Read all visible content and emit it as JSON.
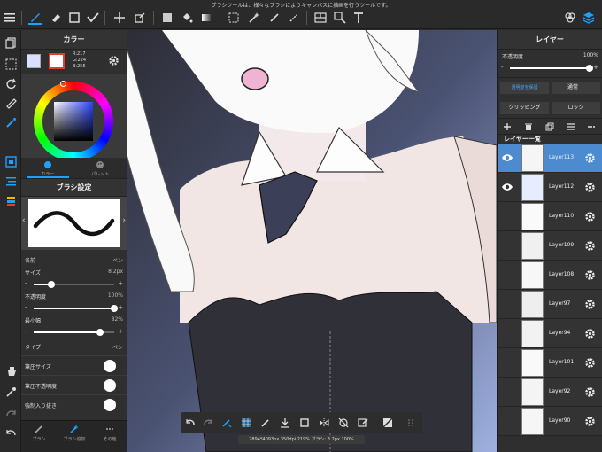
{
  "status_message": "ブラシツールは、様々なブラシによりキャンバスに描画を行うツールです。",
  "toolbar": {
    "icons": [
      "menu-icon",
      "brush-icon",
      "eraser-icon",
      "square-icon",
      "pen-icon",
      "move-icon",
      "transform-icon",
      "fill-color-icon",
      "bucket-icon",
      "gradient-icon",
      "select-rect-icon",
      "magic-wand-icon",
      "pen-select-icon",
      "select-pen-icon",
      "frame-icon",
      "filter-icon",
      "text-icon",
      "material-icon",
      "layers-icon"
    ]
  },
  "color_panel": {
    "title": "カラー",
    "rgb": {
      "r": "R:217",
      "g": "G:224",
      "b": "B:255"
    },
    "tab_color": "カラー",
    "tab_palette": "パレット"
  },
  "brush_panel": {
    "title": "ブラシ設定",
    "name_label": "名前",
    "name_value": "ペン",
    "size_label": "サイズ",
    "size_value": "8.2px",
    "size_level": 0.22,
    "opacity_label": "不透明度",
    "opacity_value": "100%",
    "opacity_level": 1.0,
    "min_width_label": "最小幅",
    "min_width_value": "82%",
    "min_width_level": 0.82,
    "type_label": "タイプ",
    "type_value": "ペン",
    "toggle1": "筆圧サイズ",
    "toggle2": "筆圧不透明度",
    "toggle3": "強制入り抜き",
    "bottom_tabs": [
      "ブラシ",
      "ブラシ追加",
      "その他"
    ]
  },
  "layer_panel": {
    "title": "レイヤー",
    "opacity_label": "不透明度",
    "opacity_value": "100%",
    "blend_protect": "透明度を保護",
    "blend_mode": "通常",
    "clipping": "クリッピング",
    "lock": "ロック",
    "list_title": "レイヤー一覧",
    "layers": [
      {
        "name": "Layer113",
        "visible": true,
        "selected": true
      },
      {
        "name": "Layer112",
        "visible": true,
        "selected": false
      },
      {
        "name": "Layer110",
        "visible": false,
        "selected": false
      },
      {
        "name": "Layer109",
        "visible": false,
        "selected": false
      },
      {
        "name": "Layer108",
        "visible": false,
        "selected": false
      },
      {
        "name": "Layer97",
        "visible": false,
        "selected": false
      },
      {
        "name": "Layer94",
        "visible": false,
        "selected": false
      },
      {
        "name": "Layer101",
        "visible": false,
        "selected": false
      },
      {
        "name": "Layer92",
        "visible": false,
        "selected": false
      },
      {
        "name": "Layer90",
        "visible": false,
        "selected": false
      }
    ]
  },
  "canvas_info": "2894*4093px 350dpi 219%  ブラシ: 8.2px 100%",
  "colors": {
    "accent": "#1ea0ff",
    "selected_layer": "#4c8bd0",
    "sub_color_border": "#e23b2f"
  }
}
